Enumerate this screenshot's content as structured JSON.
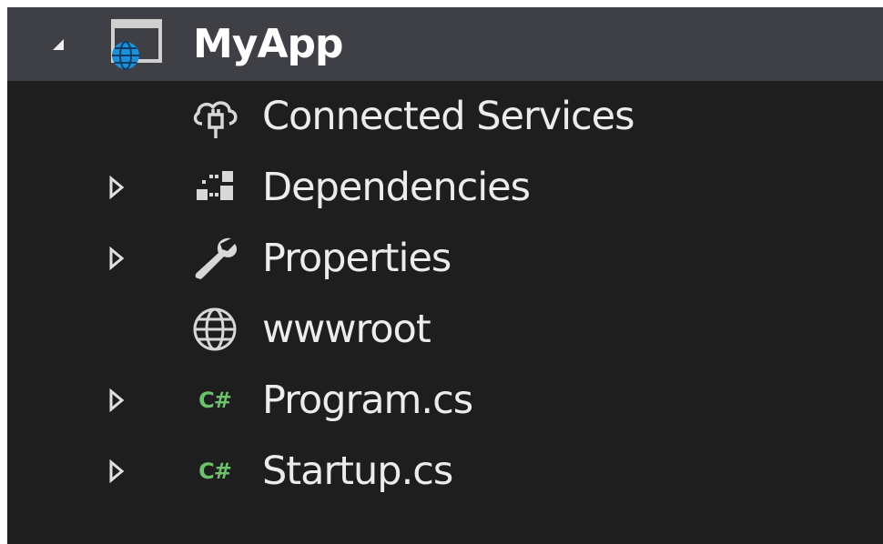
{
  "tree": {
    "root": {
      "label": "MyApp",
      "expander_icon": "expanded-triangle-icon",
      "icon": "web-project-icon"
    },
    "items": [
      {
        "label": "Connected Services",
        "icon": "cloud-plug-icon",
        "expandable": false
      },
      {
        "label": "Dependencies",
        "icon": "dependencies-icon",
        "expandable": true
      },
      {
        "label": "Properties",
        "icon": "wrench-icon",
        "expandable": true
      },
      {
        "label": "wwwroot",
        "icon": "globe-icon",
        "expandable": false
      },
      {
        "label": "Program.cs",
        "icon": "csharp-file-icon",
        "icon_text": "C#",
        "expandable": true
      },
      {
        "label": "Startup.cs",
        "icon": "csharp-file-icon",
        "icon_text": "C#",
        "expandable": true
      }
    ]
  },
  "colors": {
    "background": "#1e1e1e",
    "selected_row": "#3f3f46",
    "text": "#ececec",
    "csharp_icon": "#6cc16c",
    "globe_blue": "#1e90d6"
  }
}
